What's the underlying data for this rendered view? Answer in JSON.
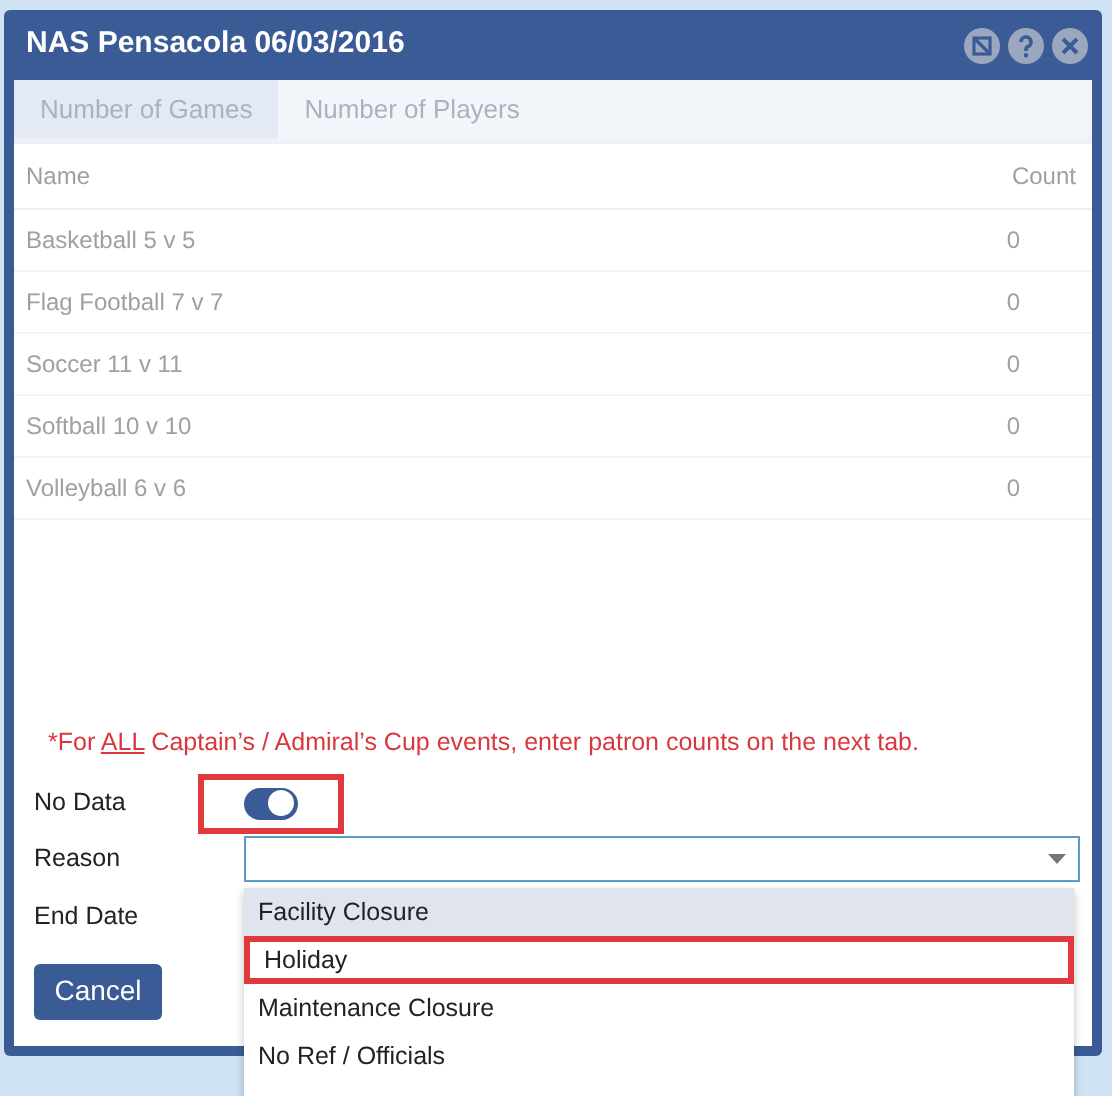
{
  "window": {
    "title": "NAS Pensacola 06/03/2016"
  },
  "tabs": [
    {
      "label": "Number of Games",
      "selected": true
    },
    {
      "label": "Number of Players",
      "selected": false
    }
  ],
  "table": {
    "columns": [
      "Name",
      "Count"
    ],
    "rows": [
      {
        "name": "Basketball 5 v 5",
        "count": "0"
      },
      {
        "name": "Flag Football 7 v 7",
        "count": "0"
      },
      {
        "name": "Soccer 11 v 11",
        "count": "0"
      },
      {
        "name": "Softball 10 v 10",
        "count": "0"
      },
      {
        "name": "Volleyball 6 v 6",
        "count": "0"
      }
    ]
  },
  "note": {
    "before": "*For ",
    "underlined": "ALL",
    "after": " Captain’s / Admiral’s Cup events, enter patron counts on the next tab."
  },
  "no_data": {
    "label": "No Data",
    "on": true,
    "highlighted": true
  },
  "reason": {
    "label": "Reason",
    "options": [
      {
        "label": "Facility Closure",
        "selected": true,
        "highlighted": false
      },
      {
        "label": "Holiday",
        "selected": false,
        "highlighted": true
      },
      {
        "label": "Maintenance Closure",
        "selected": false,
        "highlighted": false
      },
      {
        "label": "No Ref / Officials",
        "selected": false,
        "highlighted": false
      }
    ]
  },
  "end_date": {
    "label": "End Date"
  },
  "buttons": [
    "Cancel"
  ]
}
